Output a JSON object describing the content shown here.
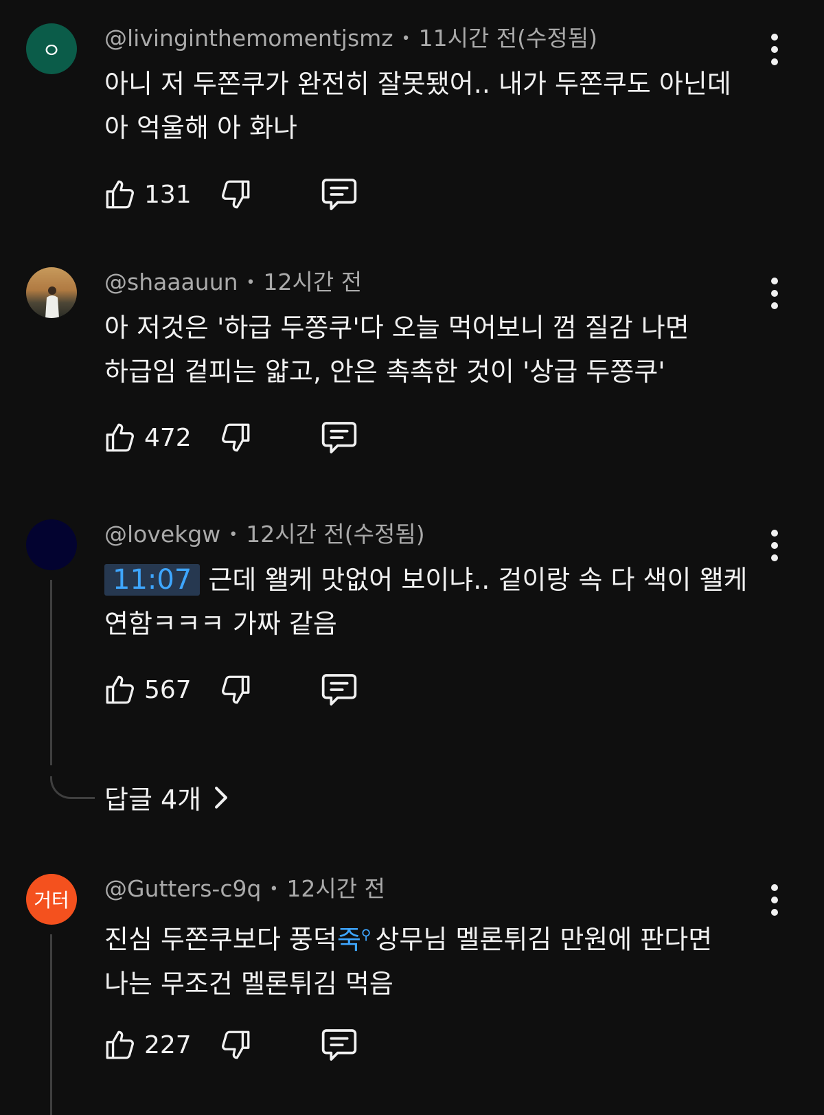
{
  "comments": [
    {
      "avatar_text": "ㅇ",
      "avatar_color": "#0b5c49",
      "author": "@livinginthemomentjsmz",
      "time": "11시간 전(수정됨)",
      "lines": [
        "아니 저 두쫀쿠가 완전히 잘못됐어.. 내가 두쫀쿠도 아닌데",
        "아 억울해 아 화나"
      ],
      "likes": "131"
    },
    {
      "avatar_text": "",
      "avatar_color": "#8a6a45",
      "author": "@shaaauun",
      "time": "12시간 전",
      "lines": [
        "아 저것은 '하급 두쫑쿠'다 오늘 먹어보니 껌 질감 나면",
        "하급임 겉피는 얇고, 안은 촉촉한 것이 '상급 두쫑쿠'"
      ],
      "likes": "472"
    },
    {
      "avatar_text": "",
      "avatar_color": "#030330",
      "author": "@lovekgw",
      "time": "12시간 전(수정됨)",
      "timestamp": "11:07",
      "line1_rest": "근데 왤케 맛없어 보이냐.. 겉이랑 속 다 색이 왤케",
      "line2": "연함ㅋㅋㅋ 가짜 같음",
      "likes": "567",
      "replies_label": "답글 4개"
    },
    {
      "avatar_text": "거터",
      "avatar_color": "#f4511e",
      "author": "@Gutters-c9q",
      "time": "12시간 전",
      "line1_pre": "진심 두쫀쿠보다 풍덕",
      "line1_link": "죽",
      "line1_post": "상무님 멜론튀김 만원에 판다면",
      "line2": "나는 무조건 멜론튀김 먹음",
      "likes": "227"
    }
  ],
  "separator": "•"
}
